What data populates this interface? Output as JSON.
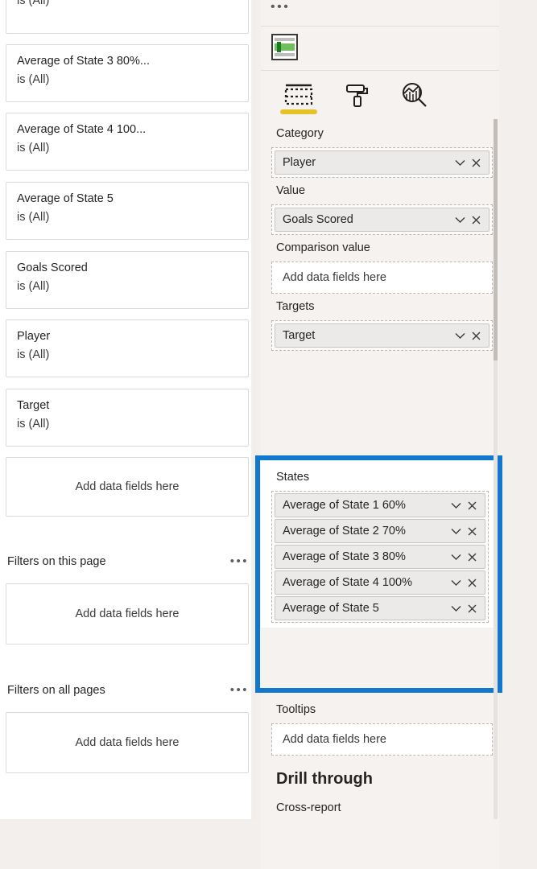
{
  "filters_pane": {
    "cards": [
      {
        "title": "",
        "value": "is (All)",
        "clipped": true
      },
      {
        "title": "Average of State 3 80%...",
        "value": "is (All)"
      },
      {
        "title": "Average of State 4 100...",
        "value": "is (All)"
      },
      {
        "title": "Average of State 5",
        "value": "is (All)"
      },
      {
        "title": "Goals Scored",
        "value": "is (All)"
      },
      {
        "title": "Player",
        "value": "is (All)"
      },
      {
        "title": "Target",
        "value": "is (All)"
      }
    ],
    "visual_dropzone_placeholder": "Add data fields here",
    "page_section": {
      "title": "Filters on this page",
      "menu_icon": "ellipsis-horizontal-icon",
      "placeholder": "Add data fields here"
    },
    "all_pages_section": {
      "title": "Filters on all pages",
      "menu_icon": "ellipsis-horizontal-icon",
      "placeholder": "Add data fields here"
    }
  },
  "visualizations_pane": {
    "menu_icon": "ellipsis-horizontal-icon",
    "visual_type": {
      "name": "bullet-chart-visual-icon",
      "selected": true,
      "accent_color": "#3aa335"
    },
    "tabs": [
      {
        "label": "",
        "icon": "fields-grid-icon",
        "active": true
      },
      {
        "label": "",
        "icon": "paint-roller-icon",
        "active": false
      },
      {
        "label": "",
        "icon": "analytics-magnifier-icon",
        "active": false
      }
    ],
    "active_tab_underline_color": "#e6c229",
    "wells": [
      {
        "label": "Category",
        "fields": [
          {
            "name": "Player",
            "dropdown_icon": "chevron-down-icon",
            "remove_icon": "close-icon"
          }
        ],
        "placeholder": null
      },
      {
        "label": "Value",
        "fields": [
          {
            "name": "Goals Scored",
            "dropdown_icon": "chevron-down-icon",
            "remove_icon": "close-icon"
          }
        ],
        "placeholder": null
      },
      {
        "label": "Comparison value",
        "fields": [],
        "placeholder": "Add data fields here"
      },
      {
        "label": "Targets",
        "fields": [
          {
            "name": "Target",
            "dropdown_icon": "chevron-down-icon",
            "remove_icon": "close-icon"
          }
        ],
        "placeholder": null
      }
    ],
    "states_well": {
      "label": "States",
      "highlighted": true,
      "highlight_color": "#1278cd",
      "fields": [
        {
          "name": "Average of State 1 60%",
          "dropdown_icon": "chevron-down-icon",
          "remove_icon": "close-icon"
        },
        {
          "name": "Average of State 2 70%",
          "dropdown_icon": "chevron-down-icon",
          "remove_icon": "close-icon"
        },
        {
          "name": "Average of State 3 80%",
          "dropdown_icon": "chevron-down-icon",
          "remove_icon": "close-icon"
        },
        {
          "name": "Average of State 4 100%",
          "dropdown_icon": "chevron-down-icon",
          "remove_icon": "close-icon"
        },
        {
          "name": "Average of State 5",
          "dropdown_icon": "chevron-down-icon",
          "remove_icon": "close-icon"
        }
      ]
    },
    "tooltips_well": {
      "label": "Tooltips",
      "placeholder": "Add data fields here"
    },
    "drill_through": {
      "heading": "Drill through",
      "cross_report_label": "Cross-report"
    }
  }
}
